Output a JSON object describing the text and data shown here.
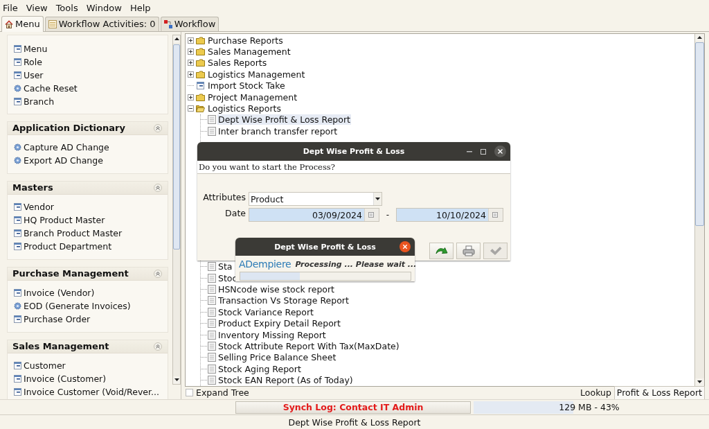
{
  "menu_bar": [
    "File",
    "View",
    "Tools",
    "Window",
    "Help"
  ],
  "tabs": [
    {
      "label": "Menu",
      "selected": true
    },
    {
      "label": "Workflow Activities: 0",
      "selected": false
    },
    {
      "label": "Workflow",
      "selected": false
    }
  ],
  "sidebar": {
    "sections": [
      {
        "items": [
          {
            "label": "Menu",
            "kind": "window"
          },
          {
            "label": "Role",
            "kind": "window"
          },
          {
            "label": "User",
            "kind": "window"
          },
          {
            "label": "Cache Reset",
            "kind": "process"
          },
          {
            "label": "Branch",
            "kind": "window"
          }
        ]
      },
      {
        "title": "Application Dictionary",
        "expanded": true,
        "items": [
          {
            "label": "Capture AD Change",
            "kind": "process"
          },
          {
            "label": "Export AD Change",
            "kind": "process"
          }
        ]
      },
      {
        "title": "Masters",
        "expanded": true,
        "items": [
          {
            "label": "Vendor",
            "kind": "window"
          },
          {
            "label": "HQ Product Master",
            "kind": "window"
          },
          {
            "label": "Branch Product Master",
            "kind": "window"
          },
          {
            "label": "Product Department",
            "kind": "window"
          }
        ]
      },
      {
        "title": "Purchase Management",
        "expanded": true,
        "items": [
          {
            "label": "Invoice (Vendor)",
            "kind": "window"
          },
          {
            "label": "EOD (Generate Invoices)",
            "kind": "process"
          },
          {
            "label": "Purchase Order",
            "kind": "window"
          }
        ]
      },
      {
        "title": "Sales Management",
        "expanded": true,
        "items": [
          {
            "label": "Customer",
            "kind": "window"
          },
          {
            "label": "Invoice (Customer)",
            "kind": "window"
          },
          {
            "label": "Invoice Customer (Void/Rever...",
            "kind": "window"
          }
        ]
      }
    ]
  },
  "tree": {
    "items": [
      {
        "label": "Purchase Reports",
        "kind": "folder",
        "expanded": false,
        "selected": false
      },
      {
        "label": "Sales Management",
        "kind": "folder",
        "expanded": false,
        "selected": false
      },
      {
        "label": "Sales Reports",
        "kind": "folder",
        "expanded": false,
        "selected": false
      },
      {
        "label": "Logistics Management",
        "kind": "folder",
        "expanded": false,
        "selected": false
      },
      {
        "label": "Import Stock Take",
        "kind": "window",
        "selected": false
      },
      {
        "label": "Project Management",
        "kind": "folder",
        "expanded": false,
        "selected": false
      },
      {
        "label": "Logistics Reports",
        "kind": "folder",
        "expanded": true,
        "selected": false,
        "children": [
          {
            "label": "Dept Wise Profit & Loss Report",
            "kind": "report",
            "selected": true
          },
          {
            "label": "Inter branch transfer report",
            "kind": "report",
            "selected": false
          },
          {
            "label": "Sta",
            "kind": "report",
            "selected": false
          },
          {
            "label": "Stoc",
            "kind": "report",
            "selected": false
          },
          {
            "label": "HSNcode wise stock report",
            "kind": "report",
            "selected": false
          },
          {
            "label": "Transaction Vs Storage Report",
            "kind": "report",
            "selected": false
          },
          {
            "label": "Stock Variance Report",
            "kind": "report",
            "selected": false
          },
          {
            "label": "Product Expiry Detail Report",
            "kind": "report",
            "selected": false
          },
          {
            "label": "Inventory Missing Report",
            "kind": "report",
            "selected": false
          },
          {
            "label": "Stock Attribute Report With Tax(MaxDate)",
            "kind": "report",
            "selected": false
          },
          {
            "label": "Selling Price Balance Sheet",
            "kind": "report",
            "selected": false
          },
          {
            "label": "Stock Aging Report",
            "kind": "report",
            "selected": false
          },
          {
            "label": "Stock EAN Report (As of Today)",
            "kind": "report",
            "selected": false
          }
        ]
      }
    ]
  },
  "expand_tree": {
    "label": "Expand Tree",
    "checked": false
  },
  "lookup": {
    "label": "Lookup",
    "value": "Profit & Loss Report"
  },
  "status_bar": {
    "message": "Synch Log: Contact IT Admin",
    "memory": {
      "reading": "129 MB - 43%",
      "level": 0.43
    }
  },
  "footer": "Dept Wise Profit & Loss Report",
  "process_dialog": {
    "title": "Dept Wise Profit & Loss",
    "prompt": "Do you want to start the Process?",
    "attributes": {
      "label": "Attributes",
      "value": "Product"
    },
    "date": {
      "label": "Date",
      "from": "03/09/2024",
      "separator": "-",
      "to": "10/10/2024"
    },
    "buttons": [
      {
        "kind": "start",
        "disabled": false
      },
      {
        "kind": "print",
        "disabled": false
      },
      {
        "kind": "ok",
        "disabled": true
      }
    ]
  },
  "progress_dialog": {
    "title": "Dept Wise Profit & Loss",
    "logo": "ADempiere",
    "message": "Processing ... Please wait ...",
    "level": 0.35
  }
}
